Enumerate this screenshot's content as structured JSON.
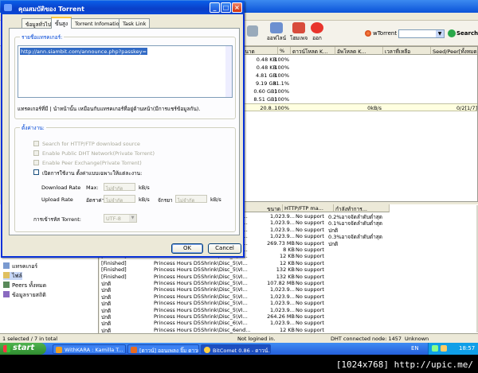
{
  "app": {
    "title": "BitComet 0.86 - ดาวน์..."
  },
  "toolbar": {
    "buttons": [
      {
        "label": "ออฟไลน์"
      },
      {
        "label": "โฮมเพจ"
      },
      {
        "label": "ออก"
      }
    ],
    "wtorrent_label": "wTorrent",
    "search_label": "Search"
  },
  "list": {
    "headers": [
      "ขนาด",
      "%",
      "ดาวน์โหลด K...",
      "อัพโหลด K...",
      "เวลาที่เหลือ",
      "Seed/Peer[ทั้งหมด]"
    ],
    "rows": [
      {
        "size": "0.48 KB",
        "pct": "100%",
        "down": "",
        "up": "",
        "seed": ""
      },
      {
        "size": "0.48 KB",
        "pct": "100%",
        "down": "",
        "up": "",
        "seed": ""
      },
      {
        "size": "4.81 GB",
        "pct": "100%",
        "down": "",
        "up": "",
        "seed": ""
      },
      {
        "size": "9.19 GB",
        "pct": "31.1%",
        "down": "",
        "up": "",
        "seed": ""
      },
      {
        "size": "0.60 GB)",
        "pct": "100%",
        "down": "",
        "up": "",
        "seed": ""
      },
      {
        "size": "8.51 GB)",
        "pct": "100%",
        "down": "",
        "up": "",
        "seed": ""
      },
      {
        "size": "20.8...",
        "pct": "100%",
        "down": "",
        "up": "0kB/s",
        "seed": "0/2[1/7]"
      }
    ]
  },
  "tree": {
    "items": [
      "แทรคเกอร์",
      "ไฟล์",
      "Peers ทั้งหมด",
      "ข้อมูลรายสถิติ"
    ]
  },
  "files": {
    "headers": [
      "ขนาด",
      "HTTP/FTP ma...",
      "กำลังทำการ..."
    ],
    "rows": [
      {
        "status": "",
        "name": "Princess Hours D5Shrink\\Disc_5\\VI...",
        "size": "1,023.9...",
        "http": "No support",
        "prio": "0.2%อาจจัดลำดับต่ำสุด"
      },
      {
        "status": "",
        "name": "Princess Hours D5Shrink\\Disc_5\\VI...",
        "size": "1,023.9...",
        "http": "No support",
        "prio": "0.1%อาจจัดลำดับต่ำสุด"
      },
      {
        "status": "",
        "name": "Princess Hours D5Shrink\\Disc_5\\VI...",
        "size": "1,023.9...",
        "http": "No support",
        "prio": "ปกติ"
      },
      {
        "status": "",
        "name": "Princess Hours D5Shrink\\Disc_5\\VI...",
        "size": "1,023.9...",
        "http": "No support",
        "prio": "0.3%อาจจัดลำดับต่ำสุด"
      },
      {
        "status": "",
        "name": "Princess Hours D5Shrink\\Disc_5\\VI...",
        "size": "269.73 MB",
        "http": "No support",
        "prio": "ปกติ"
      },
      {
        "status": "[Finished]",
        "name": "Princess Hours D5Shrink\\Disc_5\\VI...",
        "size": "8 KB",
        "http": "No support",
        "prio": ""
      },
      {
        "status": "[Finished]",
        "name": "Princess Hours D5Shrink\\Disc_5\\VI...",
        "size": "12 KB",
        "http": "No support",
        "prio": ""
      },
      {
        "status": "[Finished]",
        "name": "Princess Hours D5Shrink\\Disc_5\\VI...",
        "size": "12 KB",
        "http": "No support",
        "prio": ""
      },
      {
        "status": "[Finished]",
        "name": "Princess Hours D5Shrink\\Disc_5\\VI...",
        "size": "132 KB",
        "http": "No support",
        "prio": ""
      },
      {
        "status": "[Finished]",
        "name": "Princess Hours D5Shrink\\Disc_5\\VI...",
        "size": "132 KB",
        "http": "No support",
        "prio": ""
      },
      {
        "status": "ปกติ",
        "name": "Princess Hours D5Shrink\\Disc_5\\VI...",
        "size": "107.82 MB",
        "http": "No support",
        "prio": ""
      },
      {
        "status": "ปกติ",
        "name": "Princess Hours D5Shrink\\Disc_5\\VI...",
        "size": "1,023.9...",
        "http": "No support",
        "prio": ""
      },
      {
        "status": "ปกติ",
        "name": "Princess Hours D5Shrink\\Disc_5\\VI...",
        "size": "1,023.9...",
        "http": "No support",
        "prio": ""
      },
      {
        "status": "ปกติ",
        "name": "Princess Hours D5Shrink\\Disc_5\\VI...",
        "size": "1,023.9...",
        "http": "No support",
        "prio": ""
      },
      {
        "status": "ปกติ",
        "name": "Princess Hours D5Shrink\\Disc_5\\VI...",
        "size": "1,023.9...",
        "http": "No support",
        "prio": ""
      },
      {
        "status": "ปกติ",
        "name": "Princess Hours D5Shrink\\Disc_5\\VI...",
        "size": "264.26 MB",
        "http": "No support",
        "prio": ""
      },
      {
        "status": "ปกติ",
        "name": "Princess Hours D5Shrink\\Disc_6\\VI...",
        "size": "1,023.9...",
        "http": "No support",
        "prio": ""
      },
      {
        "status": "ปกติ",
        "name": "Princess Hours D5Shrink\\Disc_6end...",
        "size": "12 KB",
        "http": "No support",
        "prio": ""
      }
    ]
  },
  "status": {
    "selection": "1 selected / 7 in total",
    "login": "Not logined in.",
    "dht": "DHT connected node: 1457",
    "unknown": "Unknown"
  },
  "taskbar": {
    "start": "start",
    "tasks": [
      "WithKARA : Kamilla T...",
      "[ดาวน์] ออนเพลง จิ๊ม ดาวเรา...",
      "BitComet 0.86 - ดาวน์..."
    ],
    "lang": "EN",
    "clock": "18:57"
  },
  "caption": "[1024x768] http://upic.me/",
  "dialog": {
    "title": "คุณสมบัติของ Torrent",
    "tabs": [
      "ข้อมูลทั่วไป",
      "ขั้นสูง",
      "Torrent Infomation",
      "Task Link"
    ],
    "active_tab": 1,
    "tracker_group_label": "รายชื่อแทรคเกอร์:",
    "tracker_url": "http://ann.siambit.com/announce.php?passkey=",
    "tracker_note": "แทรคเกอร์ที่มี | นำหน้านั้น เหมือนกับแทรคเกอร์ที่อยู่ด้านหน้า(มีการแชร์ข้อมูลกัน).",
    "settings_group_label": "ตั้งค่างาน:",
    "options": [
      {
        "label": "Search for HTTP/FTP download source",
        "checked": false,
        "disabled": true
      },
      {
        "label": "Enable Public DHT Network(Private Torrent)",
        "checked": false,
        "disabled": true
      },
      {
        "label": "Enable Peer Exchange(Private Torrent)",
        "checked": false,
        "disabled": true
      },
      {
        "label": "เปิดการใช้งาน ตั้งค่าแบบเฉพาะให้แต่ละงาน:",
        "checked": false,
        "disabled": false
      }
    ],
    "download_rate_label": "Download Rate",
    "max_label": "Max:",
    "download_rate_value": "ไม่จำกัด",
    "unit": "kB/s",
    "upload_rate_label": "Upload Rate",
    "auto_label": "อัตราค่า",
    "upload_rate_value": "ไม่จำกัด",
    "ratio_label": "จักรยา",
    "ratio_value": "ไม่จำกัด",
    "encoding_label": "การเข้ารหัส Torrent:",
    "encoding_value": "UTF-8",
    "ok": "OK",
    "cancel": "Cancel"
  }
}
